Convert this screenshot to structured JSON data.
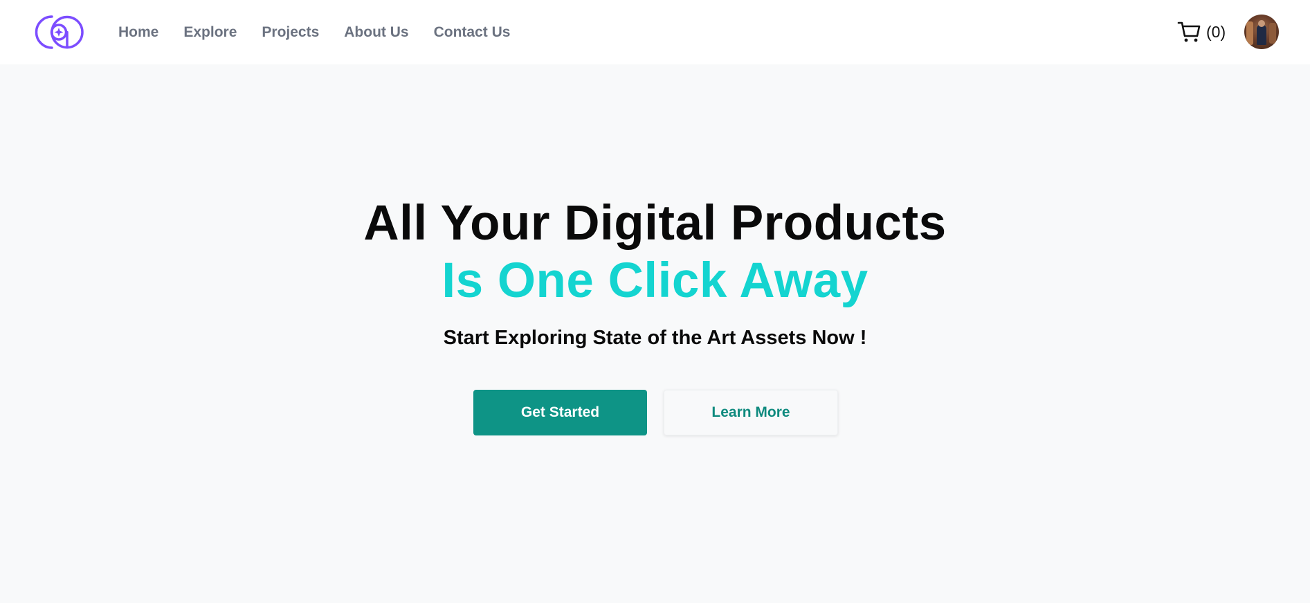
{
  "colors": {
    "brand_purple": "#7c4dff",
    "accent_teal": "#14d4d0",
    "button_teal": "#0e9486",
    "nav_text": "#6b7280",
    "background": "#f8f9fa"
  },
  "header": {
    "logo_icon": "brand-logo-icon",
    "nav": [
      {
        "label": "Home"
      },
      {
        "label": "Explore"
      },
      {
        "label": "Projects"
      },
      {
        "label": "About Us"
      },
      {
        "label": "Contact Us"
      }
    ],
    "cart": {
      "icon": "shopping-cart-icon",
      "count_label": "(0)"
    },
    "avatar_icon": "user-avatar"
  },
  "hero": {
    "title_line1": "All Your Digital Products",
    "title_line2": "Is One Click Away",
    "tagline": "Start Exploring State of the Art Assets Now !",
    "primary_button": "Get Started",
    "secondary_button": "Learn More"
  }
}
